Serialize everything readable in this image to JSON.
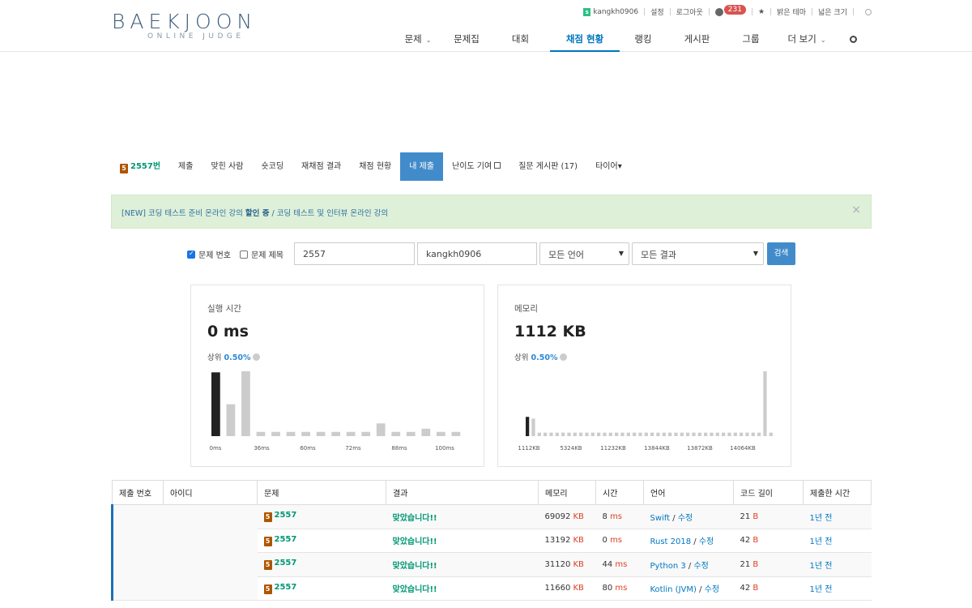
{
  "logo": {
    "main": "BAEKJOON",
    "sub": "ONLINE JUDGE"
  },
  "topbar": {
    "username": "kangkh0906",
    "settings": "설정",
    "logout": "로그아웃",
    "notifications": "231",
    "star": "★",
    "light_theme": "밝은 테마",
    "wide_size": "넓은 크기"
  },
  "mainnav": [
    {
      "label": "문제",
      "caret": true
    },
    {
      "label": "문제집"
    },
    {
      "label": "대회"
    },
    {
      "label": "채점 현황",
      "active": true
    },
    {
      "label": "랭킹"
    },
    {
      "label": "게시판"
    },
    {
      "label": "그룹"
    },
    {
      "label": "더 보기",
      "caret": true
    }
  ],
  "problem_tabs": {
    "problem": "2557번",
    "tier": "5",
    "items": [
      "제출",
      "맞힌 사람",
      "숏코딩",
      "재채점 결과",
      "채점 현황",
      "내 제출",
      "난이도 기여",
      "질문 게시판 (17)",
      "타이어"
    ]
  },
  "alert": {
    "prefix": "[NEW] 코딩 테스트 준비 온라인 강의 ",
    "bold": "할인 중",
    "suffix": " / 코딩 테스트 및 인터뷰 온라인 강의",
    "close": "×"
  },
  "filter": {
    "problem_number_label": "문제 번호",
    "problem_number_checked": true,
    "problem_title_label": "문제 제목",
    "problem_title_checked": false,
    "problem_value": "2557",
    "user_value": "kangkh0906",
    "language": "모든 언어",
    "result": "모든 결과",
    "search_button": "검색"
  },
  "stats": {
    "time": {
      "label": "실행 시간",
      "value": "0 ms",
      "rank_prefix": "상위 ",
      "rank_pct": "0.50%"
    },
    "memory": {
      "label": "메모리",
      "value": "1112 KB",
      "rank_prefix": "상위 ",
      "rank_pct": "0.50%"
    }
  },
  "chart_data": [
    {
      "type": "bar",
      "title": "실행 시간",
      "tick_labels": [
        "0ms",
        "36ms",
        "60ms",
        "72ms",
        "88ms",
        "100ms"
      ],
      "values": [
        60,
        30,
        61,
        4,
        4,
        4,
        4,
        4,
        4,
        4,
        4,
        12,
        4,
        4,
        7,
        4,
        4
      ],
      "highlight_index": 0,
      "highlight_color": "#222222",
      "bar_color": "#cccccc"
    },
    {
      "type": "bar",
      "title": "메모리",
      "tick_labels": [
        "1112KB",
        "5324KB",
        "11232KB",
        "13844KB",
        "13872KB",
        "14064KB"
      ],
      "values": [
        22,
        20,
        4,
        4,
        4,
        4,
        4,
        4,
        4,
        4,
        4,
        4,
        4,
        4,
        4,
        4,
        4,
        4,
        4,
        4,
        4,
        4,
        4,
        4,
        4,
        4,
        4,
        4,
        4,
        4,
        4,
        4,
        4,
        4,
        4,
        4,
        4,
        4,
        4,
        4,
        74,
        4
      ],
      "highlight_index": 0,
      "highlight_color": "#222222",
      "bar_color": "#cccccc"
    }
  ],
  "table": {
    "headers": [
      "제출 번호",
      "아이디",
      "문제",
      "결과",
      "메모리",
      "시간",
      "언어",
      "코드 길이",
      "제출한 시간"
    ],
    "rows": [
      {
        "problem": "2557",
        "tier": "5",
        "result": "맞았습니다!!",
        "memory": "69092",
        "memory_unit": "KB",
        "time": "8",
        "time_unit": "ms",
        "language": "Swift",
        "edit": "수정",
        "code_len": "21",
        "code_unit": "B",
        "submitted": "1년 전"
      },
      {
        "problem": "2557",
        "tier": "5",
        "result": "맞았습니다!!",
        "memory": "13192",
        "memory_unit": "KB",
        "time": "0",
        "time_unit": "ms",
        "language": "Rust 2018",
        "edit": "수정",
        "code_len": "42",
        "code_unit": "B",
        "submitted": "1년 전"
      },
      {
        "problem": "2557",
        "tier": "5",
        "result": "맞았습니다!!",
        "memory": "31120",
        "memory_unit": "KB",
        "time": "44",
        "time_unit": "ms",
        "language": "Python 3",
        "edit": "수정",
        "code_len": "21",
        "code_unit": "B",
        "submitted": "1년 전"
      },
      {
        "problem": "2557",
        "tier": "5",
        "result": "맞았습니다!!",
        "memory": "11660",
        "memory_unit": "KB",
        "time": "80",
        "time_unit": "ms",
        "language": "Kotlin (JVM)",
        "edit": "수정",
        "code_len": "42",
        "code_unit": "B",
        "submitted": "1년 전"
      }
    ]
  }
}
